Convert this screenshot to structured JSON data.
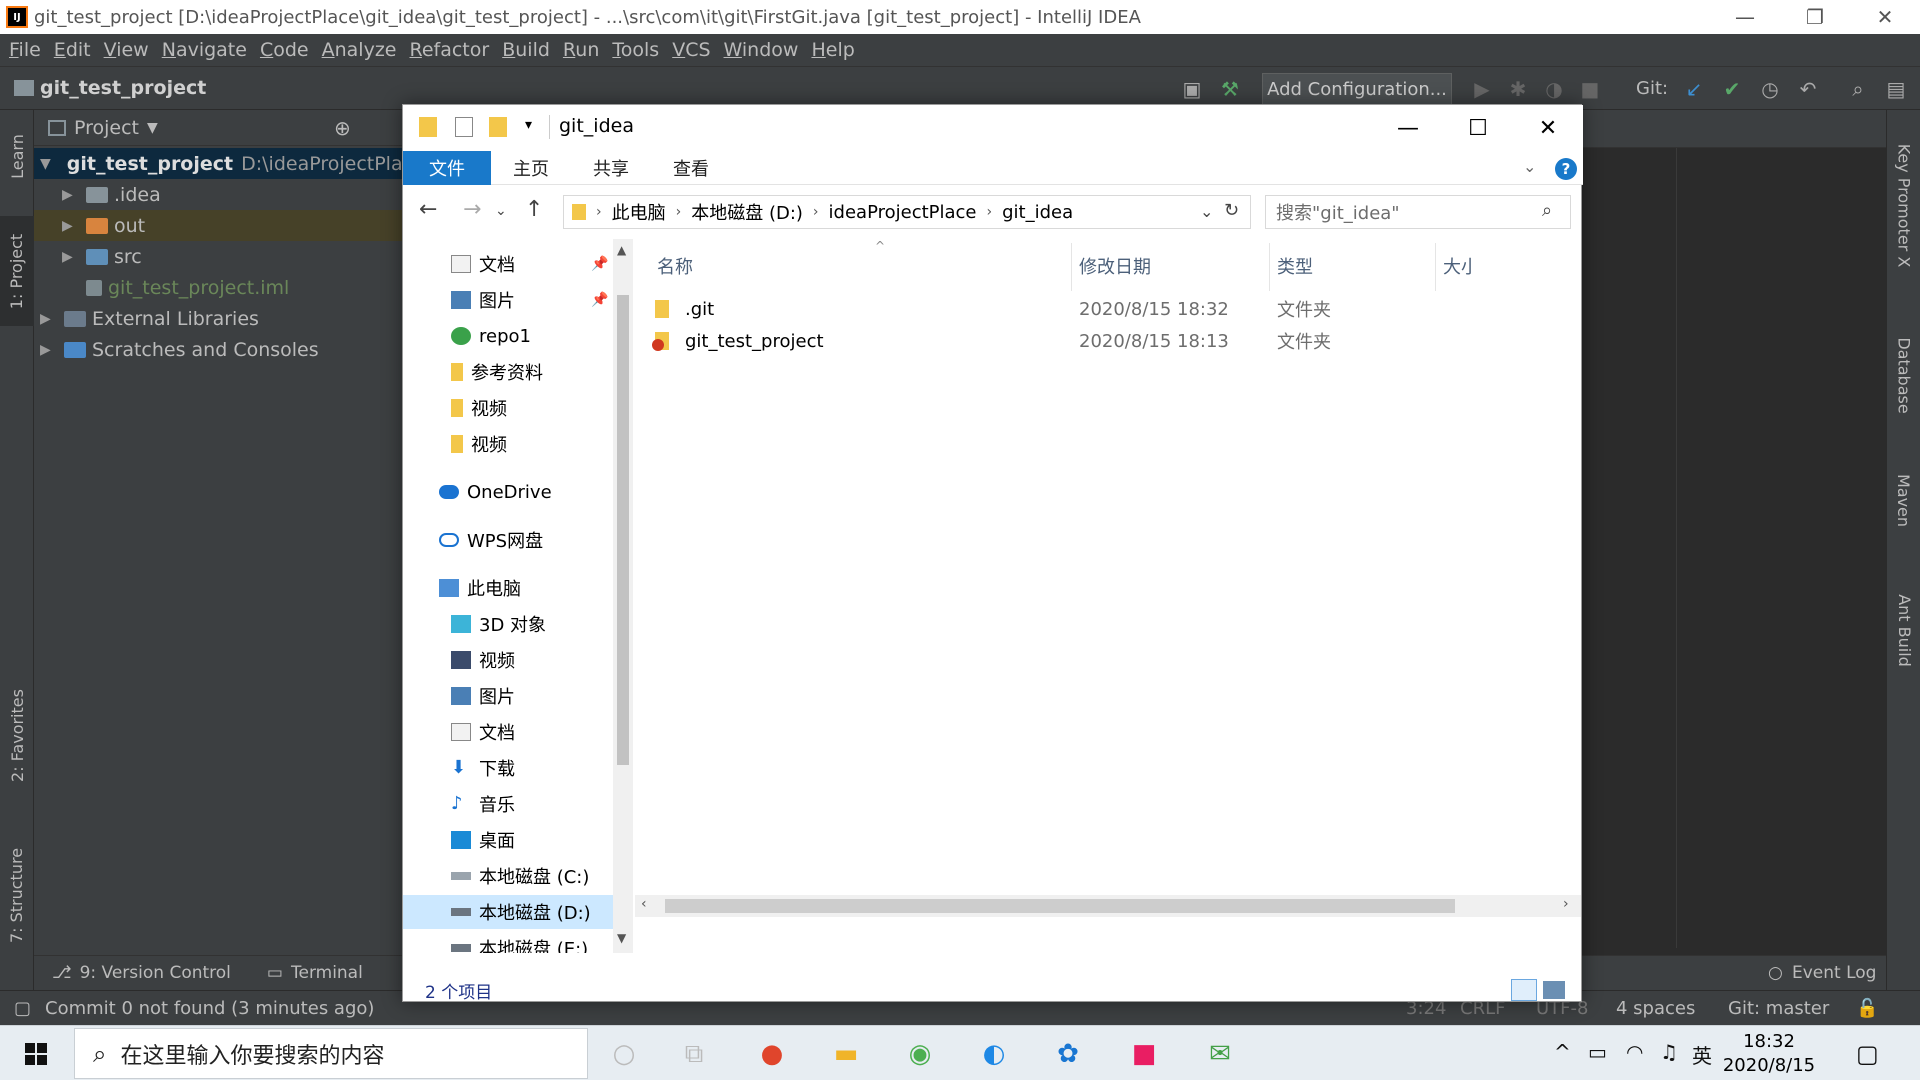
{
  "ide": {
    "window_title": "git_test_project [D:\\ideaProjectPlace\\git_idea\\git_test_project] - ...\\src\\com\\it\\git\\FirstGit.java [git_test_project] - IntelliJ IDEA",
    "menu": [
      "File",
      "Edit",
      "View",
      "Navigate",
      "Code",
      "Analyze",
      "Refactor",
      "Build",
      "Run",
      "Tools",
      "VCS",
      "Window",
      "Help"
    ],
    "nav_project": "git_test_project",
    "add_config": "Add Configuration...",
    "git_label": "Git:",
    "left_tabs": [
      "Learn",
      "1: Project",
      "2: Favorites",
      "7: Structure"
    ],
    "right_tabs": [
      "Key Promoter X",
      "Database",
      "Maven",
      "Ant Build"
    ],
    "project_header": "Project",
    "tree": [
      {
        "label": "git_test_project",
        "path": "D:\\ideaProjectPlace"
      },
      {
        "label": ".idea"
      },
      {
        "label": "out"
      },
      {
        "label": "src"
      },
      {
        "label": "git_test_project.iml"
      },
      {
        "label": "External Libraries"
      },
      {
        "label": "Scratches and Consoles"
      }
    ],
    "bottom_tools": [
      "9: Version Control",
      "Terminal"
    ],
    "event_log": "Event Log",
    "status_message": "Commit 0 not found (3 minutes ago)",
    "status_right": {
      "pos": "3:24",
      "eol": "CRLF",
      "enc": "UTF-8",
      "indent": "4 spaces",
      "branch": "Git: master"
    }
  },
  "explorer": {
    "title": "git_idea",
    "ribbon": [
      "文件",
      "主页",
      "共享",
      "查看"
    ],
    "breadcrumb": [
      "此电脑",
      "本地磁盘 (D:)",
      "ideaProjectPlace",
      "git_idea"
    ],
    "search_placeholder": "搜索\"git_idea\"",
    "nav_items": [
      {
        "label": "文档",
        "pinned": true
      },
      {
        "label": "图片",
        "pinned": true
      },
      {
        "label": "repo1"
      },
      {
        "label": "参考资料"
      },
      {
        "label": "视频"
      },
      {
        "label": "视频"
      },
      {
        "label": "OneDrive"
      },
      {
        "label": "WPS网盘"
      },
      {
        "label": "此电脑"
      },
      {
        "label": "3D 对象"
      },
      {
        "label": "视频"
      },
      {
        "label": "图片"
      },
      {
        "label": "文档"
      },
      {
        "label": "下载"
      },
      {
        "label": "音乐"
      },
      {
        "label": "桌面"
      },
      {
        "label": "本地磁盘 (C:)"
      },
      {
        "label": "本地磁盘 (D:)",
        "selected": true
      },
      {
        "label": "本地磁盘 (E:)"
      }
    ],
    "columns": [
      "名称",
      "修改日期",
      "类型",
      "大小"
    ],
    "files": [
      {
        "name": ".git",
        "modified": "2020/8/15 18:32",
        "type": "文件夹"
      },
      {
        "name": "git_test_project",
        "modified": "2020/8/15 18:13",
        "type": "文件夹"
      }
    ],
    "status": "2 个项目"
  },
  "taskbar": {
    "search_placeholder": "在这里输入你要搜索的内容",
    "ime": "英",
    "time": "18:32",
    "date": "2020/8/15"
  },
  "colors": {
    "ide_bg": "#2b2b2b",
    "ide_panel": "#3c3f41",
    "explorer_accent": "#1979ca",
    "selection": "#cce8ff"
  }
}
